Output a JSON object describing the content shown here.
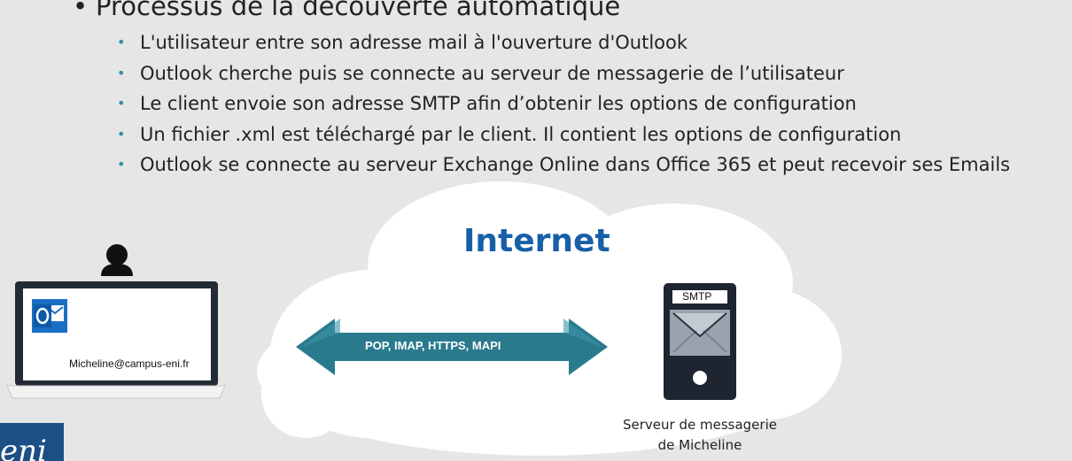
{
  "heading": "Processus de la découverte automatique",
  "bullets": [
    "L'utilisateur entre son adresse mail à l'ouverture d'Outlook",
    "Outlook cherche puis se connecte au serveur de messagerie de l’utilisateur",
    "Le client envoie son adresse SMTP afin d’obtenir les options de configuration",
    "Un fichier .xml est téléchargé par le client. Il contient les options de configuration",
    "Outlook se connecte au serveur Exchange Online dans Office 365 et peut recevoir ses Emails"
  ],
  "diagram": {
    "cloud_label": "Internet",
    "arrow_label": "POP, IMAP, HTTPS, MAPI",
    "laptop_email": "Micheline@campus-eni.fr",
    "server_badge": "SMTP",
    "server_caption_line1": "Serveur de messagerie",
    "server_caption_line2": "de Micheline",
    "logo_text": "eni"
  },
  "colors": {
    "background": "#e6e6e6",
    "accent_blue": "#1760a8",
    "arrow_teal": "#2a7a8e",
    "bullet_teal": "#2e8fa0",
    "device_dark": "#1e2430"
  }
}
